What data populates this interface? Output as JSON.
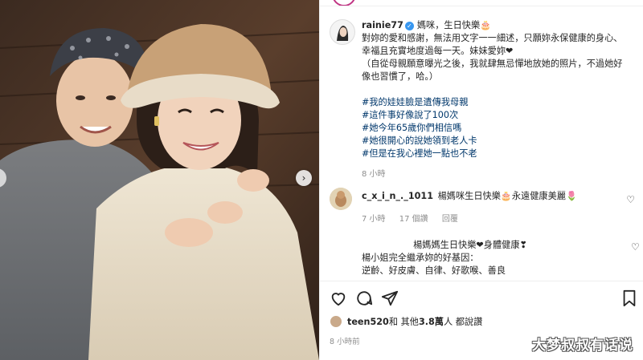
{
  "post": {
    "username": "rainie77",
    "caption_lines": [
      "媽咪，生日快樂🎂",
      "對妳的愛和感謝，無法用文字一一細述，只願妳永保健康的身心、",
      "幸福且充實地度過每一天。妹妹愛妳❤",
      "（自從母親願意曝光之後，我就肆無忌憚地放她的照片，不過她好",
      "像也習慣了，哈。）"
    ],
    "hashtags": [
      "#我的娃娃臉是遺傳我母親",
      "#這件事好像說了100次",
      "#她今年65歲你們相信嗎",
      "#她很開心的說她領到老人卡",
      "#但是在我心裡她一點也不老"
    ],
    "caption_time": "8 小時"
  },
  "comment1": {
    "username": "c_x_i_n_._1011",
    "text": "楊媽咪生日快樂🎂永遠健康美麗🌷",
    "time": "7 小時",
    "likes": "17 個讚",
    "reply": "回覆"
  },
  "comment2": {
    "line1": "楊媽媽生日快樂❤身體健康❣",
    "line2": "楊小姐完全繼承妳的好基因：",
    "line3": "逆齡、好皮膚、自律、好歌喉、善良"
  },
  "likes": {
    "user": "teen520",
    "middle": " 和 其他 ",
    "count": "3.8萬",
    "suffix": " 人 都說讚"
  },
  "timestamp": "8 小時前",
  "watermark": "大梦叔叔有话说",
  "icons": {
    "like": "heart-icon",
    "comment": "comment-icon",
    "share": "send-icon",
    "save": "bookmark-icon",
    "next": "chevron-right-icon"
  },
  "colors": {
    "verified": "#3897f0",
    "hashtag": "#00376b",
    "meta": "#8e8e8e"
  }
}
